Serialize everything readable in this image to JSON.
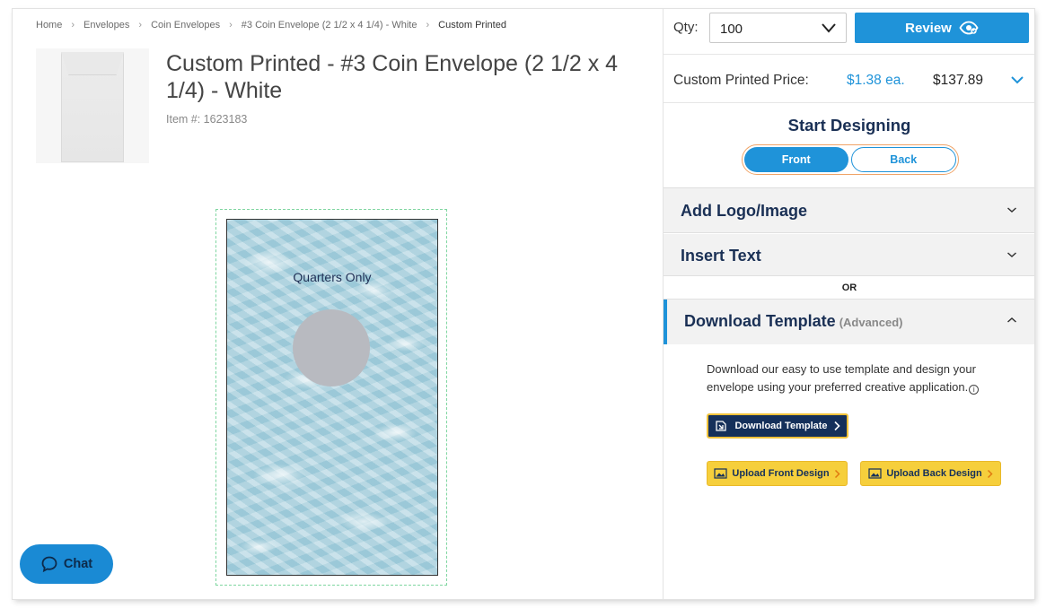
{
  "breadcrumb": [
    {
      "label": "Home"
    },
    {
      "label": "Envelopes"
    },
    {
      "label": "Coin Envelopes"
    },
    {
      "label": "#3 Coin Envelope (2 1/2 x 4 1/4) - White"
    },
    {
      "label": "Custom Printed"
    }
  ],
  "product": {
    "title": "Custom Printed - #3 Coin Envelope (2 1/2 x 4 1/4) - White",
    "item_number": "Item #: 1623183"
  },
  "preview": {
    "envelope_text": "Quarters Only",
    "background_color": "#a8d0dd"
  },
  "chat": {
    "label": "Chat",
    "icon": "chat-bubble-icon"
  },
  "order": {
    "qty_label": "Qty:",
    "qty_value": "100",
    "review_label": "Review",
    "price_label": "Custom Printed Price:",
    "price_each": "$1.38 ea.",
    "price_total": "$137.89"
  },
  "designer": {
    "title": "Start Designing",
    "sides": [
      "Front",
      "Back"
    ],
    "active_side": "Front"
  },
  "accordions": {
    "add_logo": "Add Logo/Image",
    "insert_text": "Insert Text",
    "or_label": "OR",
    "download_template": "Download Template",
    "advanced": "(Advanced)"
  },
  "download": {
    "description": "Download our easy to use template and design your envelope using your preferred creative application.",
    "download_btn": "Download Template",
    "upload_front_btn": "Upload Front Design",
    "upload_back_btn": "Upload Back Design"
  },
  "colors": {
    "accent": "#1f93d9",
    "navy": "#1a3055",
    "yellow": "#f6cf3c",
    "toggle_border": "#f0a366",
    "safe_zone": "#7fd6a0"
  }
}
